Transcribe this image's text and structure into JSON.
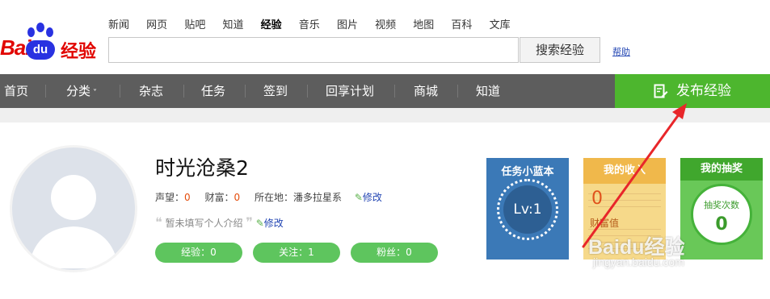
{
  "logo": {
    "bai": "Bai",
    "du": "du",
    "jingyan": "经验"
  },
  "top_nav": [
    "新闻",
    "网页",
    "贴吧",
    "知道",
    "经验",
    "音乐",
    "图片",
    "视频",
    "地图",
    "百科",
    "文库"
  ],
  "top_nav_active": "经验",
  "search": {
    "value": "",
    "button_label": "搜索经验"
  },
  "help_label": "帮助",
  "main_nav": [
    "首页",
    "分类",
    "杂志",
    "任务",
    "签到",
    "回享计划",
    "商城",
    "知道"
  ],
  "publish_label": "发布经验",
  "profile": {
    "username": "时光沧桑2",
    "reputation_label": "声望：",
    "reputation_value": "0",
    "wealth_label": "财富：",
    "wealth_value": "0",
    "location_label": "所在地：",
    "location_value": "潘多拉星系",
    "edit_label": "修改",
    "intro": "暂未填写个人介绍",
    "intro_edit_label": "修改"
  },
  "pills": [
    "经验：0",
    "关注：1",
    "粉丝：0"
  ],
  "cards": {
    "task": {
      "title": "任务小蓝本",
      "level": "Lv:1"
    },
    "income": {
      "title": "我的收入",
      "value": "0",
      "label": "财富值"
    },
    "lottery": {
      "title": "我的抽奖",
      "label": "抽奖次数",
      "value": "0"
    }
  },
  "watermark": {
    "brand": "Baidu经验",
    "url": "jingyan.baidu.com"
  },
  "colors": {
    "nav_bg": "#5d5d5d",
    "publish_green": "#4db62e",
    "task_blue": "#3b79b7",
    "income_yellow": "#f6d98a",
    "lottery_green": "#69c858",
    "annotation_red": "#e8262a"
  }
}
